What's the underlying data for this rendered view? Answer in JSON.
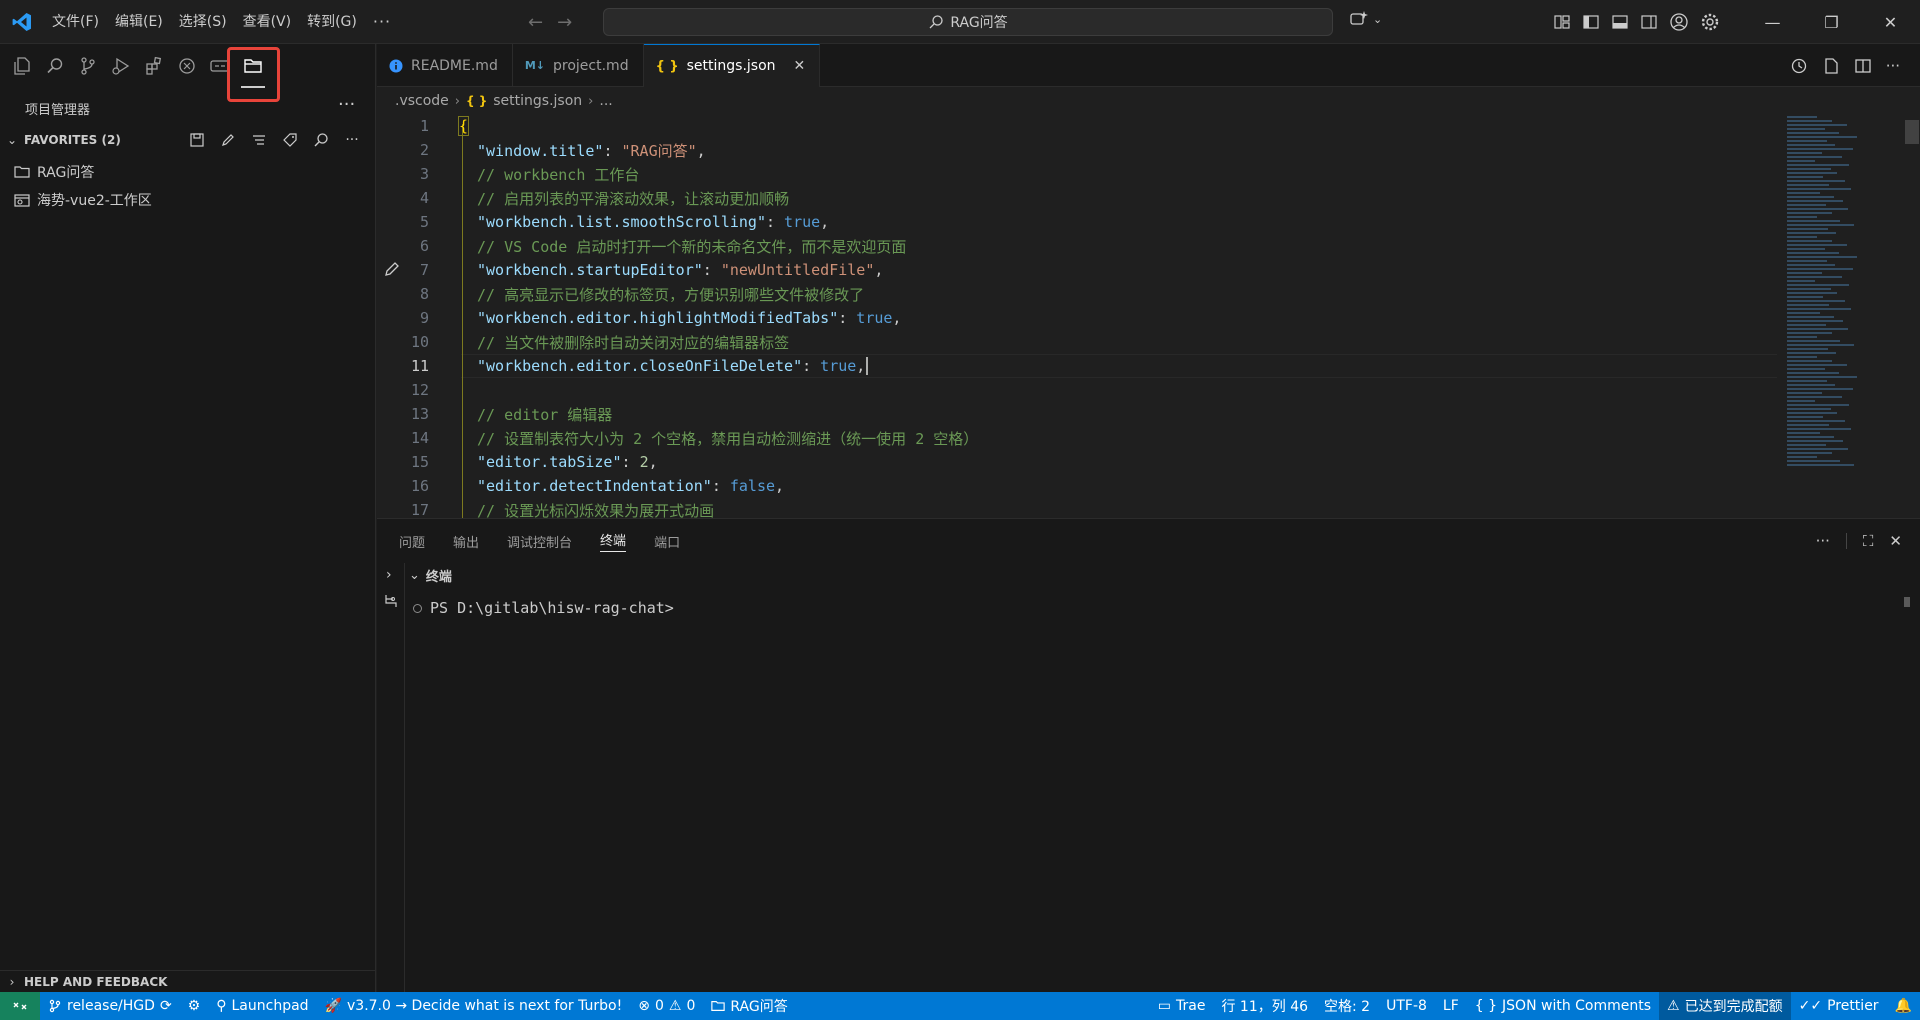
{
  "colors": {
    "accent": "#0078d4",
    "statusbar": "#0078d4",
    "remote": "#16825d",
    "highlight": "#e8443a"
  },
  "menu": [
    "文件(F)",
    "编辑(E)",
    "选择(S)",
    "查看(V)",
    "转到(G)",
    "···"
  ],
  "command_center": {
    "label": "RAG问答",
    "icon": "search-icon"
  },
  "sidebar": {
    "title": "项目管理器",
    "favorites_label": "FAVORITES (2)",
    "items": [
      "RAG问答",
      "海势-vue2-工作区"
    ],
    "help_label": "HELP AND FEEDBACK"
  },
  "tabs": [
    {
      "label": "README.md",
      "icon": "info-icon"
    },
    {
      "label": "project.md",
      "icon": "markdown-icon"
    },
    {
      "label": "settings.json",
      "icon": "json-braces-icon",
      "active": true
    }
  ],
  "breadcrumb": [
    ".vscode",
    "settings.json",
    "..."
  ],
  "editor": {
    "line_numbers": [
      "1",
      "2",
      "3",
      "4",
      "5",
      "6",
      "7",
      "8",
      "9",
      "10",
      "11",
      "12",
      "13",
      "14",
      "15",
      "16",
      "17"
    ],
    "current_line": "11"
  },
  "panel": {
    "tabs": [
      "问题",
      "输出",
      "调试控制台",
      "终端",
      "端口"
    ],
    "active_tab": "终端",
    "terminal_title": "终端",
    "prompt": "PS D:\\gitlab\\hisw-rag-chat>"
  },
  "statusbar": {
    "branch": "release/HGD",
    "launchpad": "Launchpad",
    "turbo": "v3.7.0 → Decide what is next for Turbo!",
    "errors": "0",
    "warnings": "0",
    "project": "RAG问答",
    "trae": "Trae",
    "position": "行 11，列 46",
    "spaces": "空格: 2",
    "encoding": "UTF-8",
    "eol": "LF",
    "language": "JSON with Comments",
    "quota": "已达到完成配额",
    "prettier": "Prettier"
  }
}
